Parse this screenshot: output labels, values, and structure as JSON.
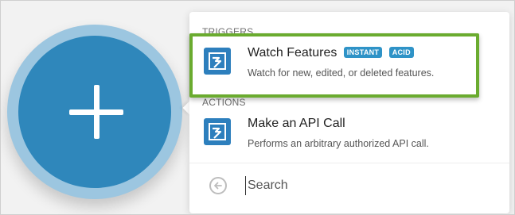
{
  "triggers": {
    "label": "TRIGGERS",
    "items": [
      {
        "title": "Watch Features",
        "badges": [
          "INSTANT",
          "ACID"
        ],
        "description": "Watch for new, edited, or deleted features.",
        "icon": "arcgis-app-icon"
      }
    ]
  },
  "actions": {
    "label": "ACTIONS",
    "items": [
      {
        "title": "Make an API Call",
        "description": "Performs an arbitrary authorized API call.",
        "icon": "arcgis-app-icon"
      }
    ]
  },
  "search": {
    "placeholder": "Search"
  },
  "colors": {
    "module": "#2f87bb",
    "module_ring": "#9cc6e0",
    "badge": "#2f93c7",
    "highlight": "#6aab2f",
    "app_icon": "#2d7fbd"
  }
}
